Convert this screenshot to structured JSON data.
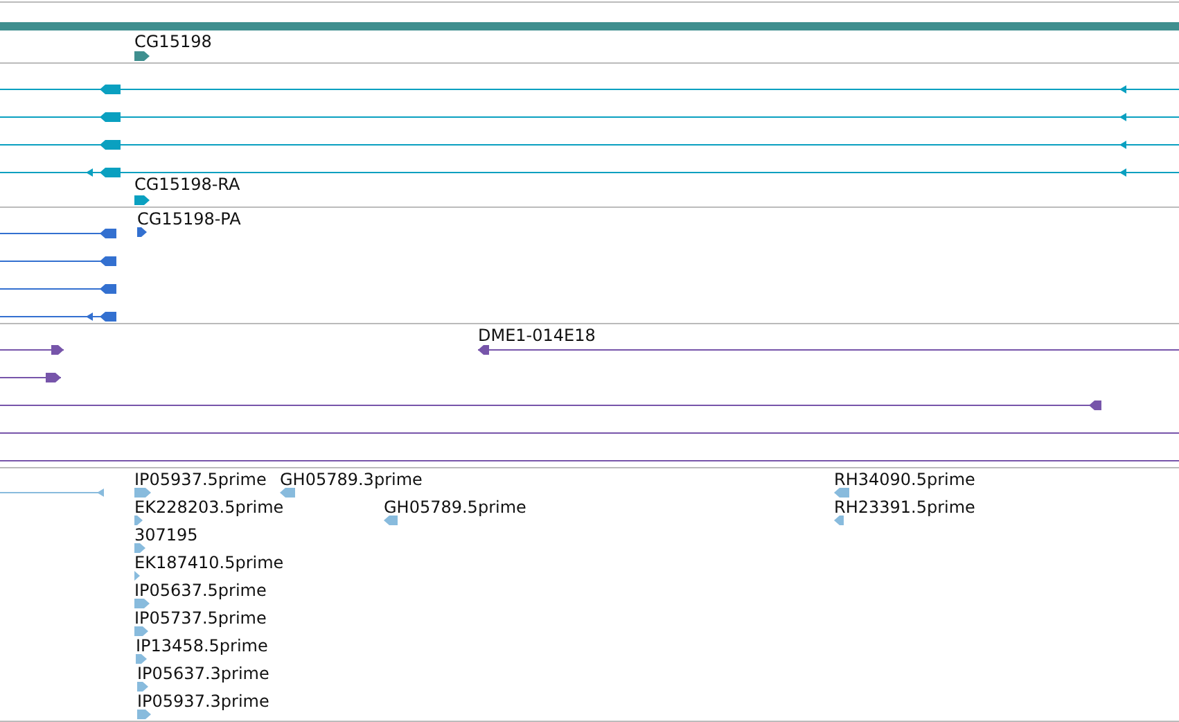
{
  "tracks": [
    {
      "kind": "summary",
      "color": "#3f8f8f",
      "features": [
        {
          "kind": "feature",
          "label": "CG15198",
          "reverse": false
        }
      ]
    },
    {
      "kind": "transcripts",
      "color": "#0aa0c0",
      "features": [
        {
          "kind": "feature",
          "reverse": true
        },
        {
          "kind": "feature",
          "reverse": true
        },
        {
          "kind": "feature",
          "reverse": true
        },
        {
          "kind": "feature",
          "reverse": true
        },
        {
          "kind": "feature",
          "label": "CG15198-RA",
          "reverse": false
        }
      ]
    },
    {
      "kind": "transcripts",
      "color": "#3370d0",
      "features": [
        {
          "kind": "feature",
          "label": "CG15198-PA",
          "reverse": false
        },
        {
          "kind": "feature",
          "reverse": true
        },
        {
          "kind": "feature",
          "reverse": true
        },
        {
          "kind": "feature",
          "reverse": true
        },
        {
          "kind": "feature",
          "reverse": true
        }
      ]
    },
    {
      "kind": "transcripts",
      "color": "#7755aa",
      "features": [
        {
          "kind": "feature",
          "reverse": false
        },
        {
          "kind": "feature",
          "label": "DME1-014E18",
          "reverse": true
        },
        {
          "kind": "feature",
          "reverse": false
        },
        {
          "kind": "feature",
          "reverse": true
        },
        {
          "kind": "line"
        },
        {
          "kind": "line"
        }
      ]
    },
    {
      "kind": "transcripts",
      "color": "#88bbdd",
      "features": [
        {
          "kind": "feature",
          "reverse": true
        },
        {
          "kind": "feature",
          "label": "IP05937.5prime",
          "reverse": false
        },
        {
          "kind": "feature",
          "label": "GH05789.3prime",
          "reverse": true
        },
        {
          "kind": "feature",
          "label": "RH34090.5prime",
          "reverse": true
        },
        {
          "kind": "feature",
          "label": "EK228203.5prime",
          "reverse": false
        },
        {
          "kind": "feature",
          "label": "GH05789.5prime",
          "reverse": true
        },
        {
          "kind": "feature",
          "label": "RH23391.5prime",
          "reverse": true
        },
        {
          "kind": "feature",
          "label": "307195",
          "reverse": false
        },
        {
          "kind": "feature",
          "label": "EK187410.5prime",
          "reverse": false
        },
        {
          "kind": "feature",
          "label": "IP05637.5prime",
          "reverse": false
        },
        {
          "kind": "feature",
          "label": "IP05737.5prime",
          "reverse": false
        },
        {
          "kind": "feature",
          "label": "IP13458.5prime",
          "reverse": false
        },
        {
          "kind": "feature",
          "label": "IP05637.3prime",
          "reverse": false
        },
        {
          "kind": "feature",
          "label": "IP05937.3prime",
          "reverse": false
        }
      ]
    }
  ]
}
